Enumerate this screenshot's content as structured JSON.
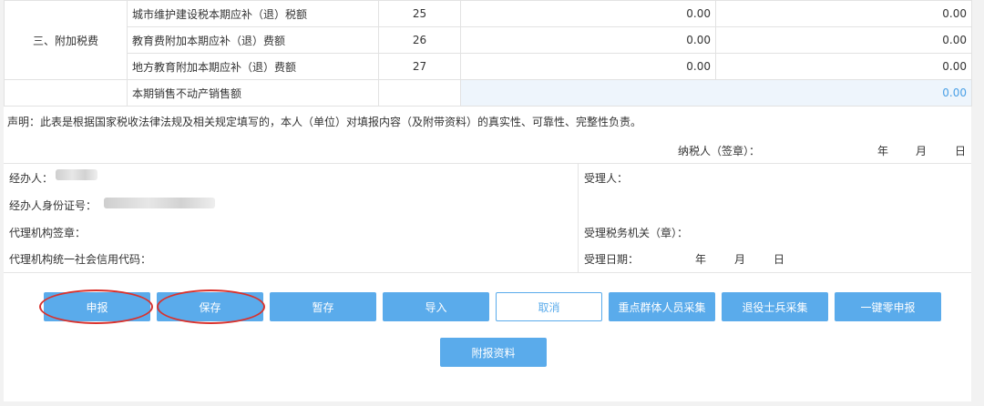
{
  "table": {
    "group_label": "三、附加税费",
    "rows": [
      {
        "label": "城市维护建设税本期应补（退）税额",
        "line": "25",
        "current": "0.00",
        "cumulative": "0.00"
      },
      {
        "label": "教育费附加本期应补（退）费额",
        "line": "26",
        "current": "0.00",
        "cumulative": "0.00"
      },
      {
        "label": "地方教育附加本期应补（退）费额",
        "line": "27",
        "current": "0.00",
        "cumulative": "0.00"
      }
    ],
    "realestate": {
      "label": "本期销售不动产销售额",
      "value": "0.00"
    }
  },
  "declaration": {
    "statement": "声明：此表是根据国家税收法律法规及相关规定填写的，本人（单位）对填报内容（及附带资料）的真实性、可靠性、完整性负责。",
    "taxpayer_seal": "纳税人（签章）：",
    "year": "年",
    "month": "月",
    "day": "日"
  },
  "agent": {
    "handler_label": "经办人：",
    "handler_id_label": "经办人身份证号：",
    "agency_seal_label": "代理机构签章：",
    "agency_code_label": "代理机构统一社会信用代码："
  },
  "acceptance": {
    "receiver_label": "受理人：",
    "tax_office_label": "受理税务机关（章）：",
    "date_label": "受理日期：",
    "year": "年",
    "month": "月",
    "day": "日"
  },
  "buttons": {
    "submit": "申报",
    "save": "保存",
    "temp_save": "暂存",
    "import": "导入",
    "cancel": "取消",
    "key_group": "重点群体人员采集",
    "veteran": "退役士兵采集",
    "zero_declare": "一键零申报",
    "attachments": "附报资料"
  },
  "colors": {
    "button": "#5aabeb",
    "highlight_cell": "#eef5fc",
    "annotation_circle": "#d9322d"
  }
}
